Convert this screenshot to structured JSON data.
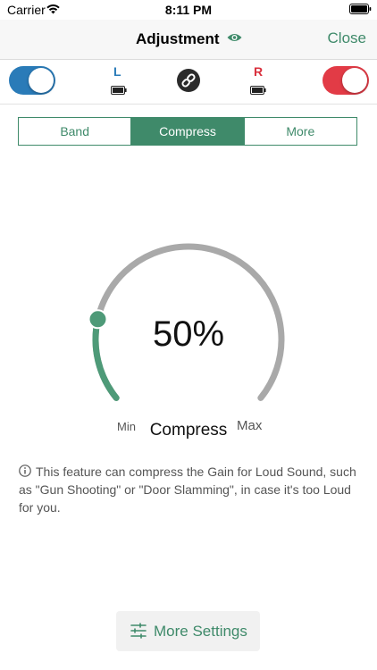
{
  "status_bar": {
    "carrier": "Carrier",
    "time": "8:11 PM"
  },
  "nav": {
    "title": "Adjustment",
    "close_label": "Close"
  },
  "devices": {
    "left_label": "L",
    "right_label": "R",
    "left_enabled": true,
    "right_enabled": true,
    "left_color": "#2a7bb8",
    "right_color": "#e23b46",
    "link_icon": "link-icon"
  },
  "tabs": [
    {
      "label": "Band",
      "active": false
    },
    {
      "label": "Compress",
      "active": true
    },
    {
      "label": "More",
      "active": false
    }
  ],
  "dial": {
    "value_text": "50%",
    "value": 0.5,
    "label": "Compress",
    "min_label": "Min",
    "max_label": "Max",
    "active_color": "#4e9a78",
    "track_color": "#a9a9a9"
  },
  "info": {
    "icon": "info-icon",
    "text": "This feature can compress the Gain for Loud Sound, such as \"Gun Shooting\" or \"Door Slamming\", in case it's too Loud for you."
  },
  "footer": {
    "more_settings_label": "More Settings",
    "icon": "sliders-icon"
  },
  "accent_color": "#3f8a6a"
}
